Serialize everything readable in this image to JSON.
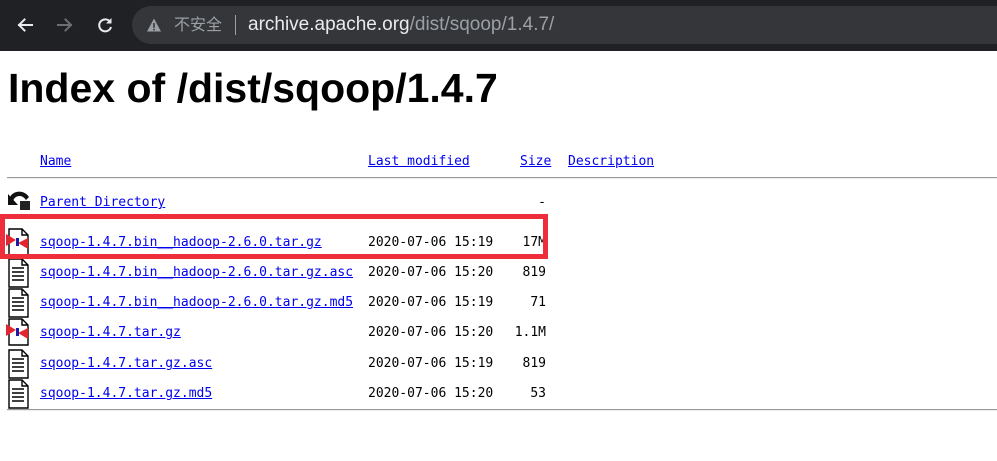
{
  "browser": {
    "security_label": "不安全",
    "url_host": "archive.apache.org",
    "url_path": "/dist/sqoop/1.4.7/"
  },
  "page": {
    "title": "Index of /dist/sqoop/1.4.7",
    "columns": {
      "name": "Name",
      "last_modified": "Last modified",
      "size": "Size",
      "description": "Description"
    },
    "parent": {
      "name": "Parent Directory",
      "size": "-"
    },
    "files": [
      {
        "name": "sqoop-1.4.7.bin__hadoop-2.6.0.tar.gz",
        "modified": "2020-07-06 15:19",
        "size": "17M",
        "icon": "compressed-file-icon"
      },
      {
        "name": "sqoop-1.4.7.bin__hadoop-2.6.0.tar.gz.asc",
        "modified": "2020-07-06 15:20",
        "size": "819",
        "icon": "text-file-icon"
      },
      {
        "name": "sqoop-1.4.7.bin__hadoop-2.6.0.tar.gz.md5",
        "modified": "2020-07-06 15:19",
        "size": "71",
        "icon": "text-file-icon"
      },
      {
        "name": "sqoop-1.4.7.tar.gz",
        "modified": "2020-07-06 15:20",
        "size": "1.1M",
        "icon": "compressed-file-icon"
      },
      {
        "name": "sqoop-1.4.7.tar.gz.asc",
        "modified": "2020-07-06 15:19",
        "size": "819",
        "icon": "text-file-icon"
      },
      {
        "name": "sqoop-1.4.7.tar.gz.md5",
        "modified": "2020-07-06 15:20",
        "size": "53",
        "icon": "text-file-icon"
      }
    ]
  },
  "annotation": {
    "highlight_color": "#ee2e3a"
  }
}
